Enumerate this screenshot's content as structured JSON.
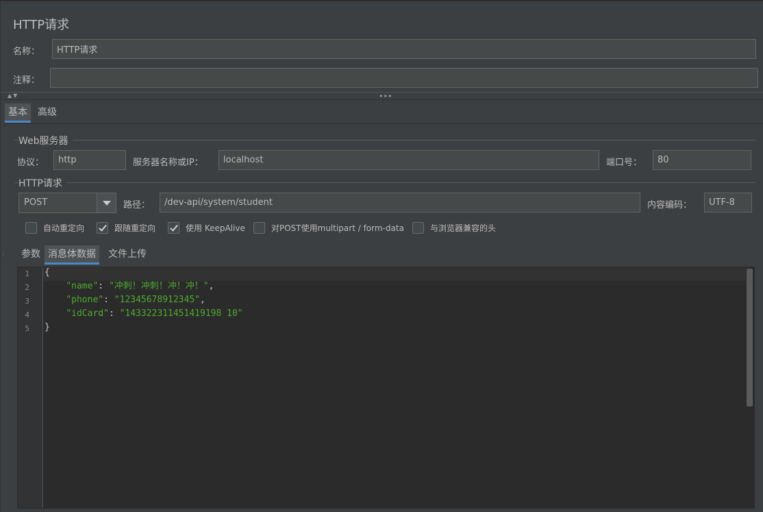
{
  "panel": {
    "title": "HTTP请求"
  },
  "name_row": {
    "label": "名称：",
    "value": "HTTP请求"
  },
  "comment_row": {
    "label": "注释：",
    "value": ""
  },
  "splitter": {
    "arrows": "▲▼",
    "dots": "•••"
  },
  "main_tabs": {
    "basic": "基本",
    "advanced": "高级"
  },
  "web_server": {
    "group_title": "Web服务器",
    "protocol_label": "协议：",
    "protocol_value": "http",
    "server_label": "服务器名称或IP：",
    "server_value": "localhost",
    "port_label": "端口号：",
    "port_value": "80"
  },
  "http_request": {
    "group_title": "HTTP请求",
    "method": "POST",
    "path_label": "路径：",
    "path_value": "/dev-api/system/student",
    "encoding_label": "内容编码：",
    "encoding_value": "UTF-8"
  },
  "options": [
    {
      "label": "自动重定向",
      "checked": false
    },
    {
      "label": "跟随重定向",
      "checked": true
    },
    {
      "label": "使用 KeepAlive",
      "checked": true
    },
    {
      "label": "对POST使用multipart / form-data",
      "checked": false
    },
    {
      "label": "与浏览器兼容的头",
      "checked": false
    }
  ],
  "sub_tabs": {
    "params": "参数",
    "body": "消息体数据",
    "files": "文件上传"
  },
  "editor": {
    "line_numbers": [
      "1",
      "2",
      "3",
      "4",
      "5"
    ],
    "brace_open": "{",
    "brace_close": "}",
    "fields": [
      {
        "key": "\"name\"",
        "value": "\"冲刺！冲刺！冲！冲！\"",
        "comma": ","
      },
      {
        "key": "\"phone\"",
        "value": "\"12345678912345\"",
        "comma": ","
      },
      {
        "key": "\"idCard\"",
        "value": "\"143322311451419198 10\"",
        "comma": ""
      }
    ]
  },
  "colors": {
    "accent": "#4a88c7",
    "json_string": "#4eac2e",
    "background": "#3c3f41",
    "editor_bg": "#2b2b2b"
  }
}
